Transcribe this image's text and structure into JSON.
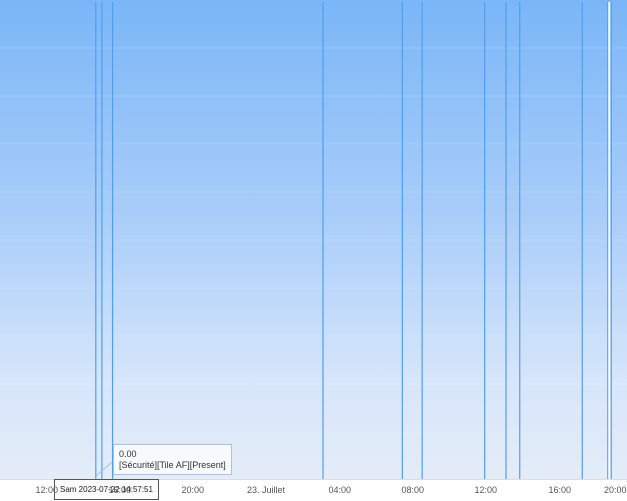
{
  "chart_data": {
    "type": "line",
    "x_ticks": [
      "12:00",
      "16:00",
      "20:00",
      "23. Juillet",
      "04:00",
      "08:00",
      "12:00",
      "16:00",
      "20:00"
    ],
    "spikes": [
      {
        "time": "2023-07-22 14:40",
        "value": 1
      },
      {
        "time": "2023-07-22 15:00",
        "value": 1
      },
      {
        "time": "2023-07-22 15:35",
        "value": 1
      },
      {
        "time": "2023-07-23 03:05",
        "value": 1
      },
      {
        "time": "2023-07-23 07:25",
        "value": 1
      },
      {
        "time": "2023-07-23 08:30",
        "value": 1
      },
      {
        "time": "2023-07-23 11:55",
        "value": 1
      },
      {
        "time": "2023-07-23 13:05",
        "value": 1
      },
      {
        "time": "2023-07-23 13:50",
        "value": 1
      },
      {
        "time": "2023-07-23 17:15",
        "value": 1
      },
      {
        "time": "2023-07-23 18:40",
        "value": 1
      },
      {
        "time": "2023-07-23 18:50",
        "value": 1
      }
    ],
    "tooltip": {
      "value": "0.00",
      "series": "[Sécurité][Tile AF][Present]"
    },
    "crosshair_label": "Sam 2023-07-22 14:57:51",
    "grid": true
  }
}
